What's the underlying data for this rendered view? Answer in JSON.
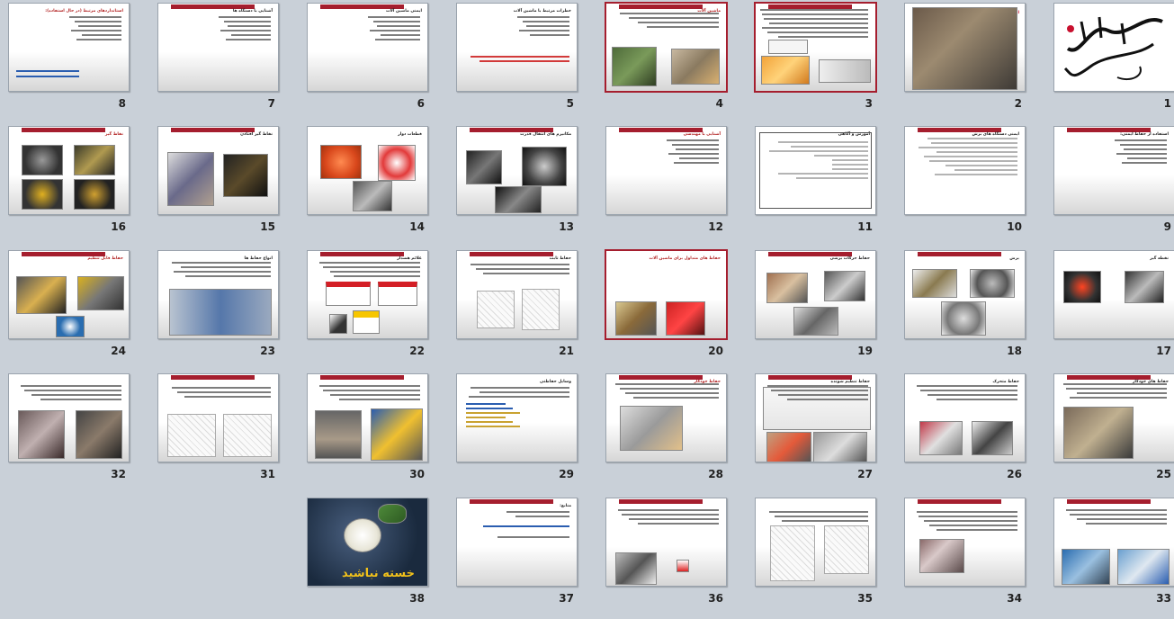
{
  "slides": [
    {
      "number": "1",
      "title": "",
      "kind": "calligraphy"
    },
    {
      "number": "2",
      "title": "ایمنی ماشین آلات",
      "kind": "photo"
    },
    {
      "number": "3",
      "title": "",
      "kind": "text-diagram",
      "selected": true
    },
    {
      "number": "4",
      "title": "ماشین آلات",
      "kind": "text-photos",
      "selected": true
    },
    {
      "number": "5",
      "title": "خطرات مرتبط با ماشین آلات",
      "kind": "list"
    },
    {
      "number": "6",
      "title": "ایمنی ماشین آلات",
      "kind": "list"
    },
    {
      "number": "7",
      "title": "آشنایی با دستگاه ها",
      "kind": "list"
    },
    {
      "number": "8",
      "title": "استانداردهای مرتبط (در حال استفاده):",
      "kind": "list"
    },
    {
      "number": "9",
      "title": "استفاده از حفاظ ایمنی:",
      "kind": "list"
    },
    {
      "number": "10",
      "title": "ایمنی دستگاه های برش",
      "kind": "text"
    },
    {
      "number": "11",
      "title": "آموزش و آگاهی",
      "kind": "framed-text"
    },
    {
      "number": "12",
      "title": "آشنایی با مهندسی",
      "kind": "list"
    },
    {
      "number": "13",
      "title": "مکانیزم های انتقال قدرت",
      "kind": "photos"
    },
    {
      "number": "14",
      "title": "قطعات دوار",
      "kind": "photos"
    },
    {
      "number": "15",
      "title": "نقاط گیر افتادن",
      "kind": "photos"
    },
    {
      "number": "16",
      "title": "نقاط گیر",
      "kind": "photos"
    },
    {
      "number": "17",
      "title": "نقطه گیر",
      "kind": "photos"
    },
    {
      "number": "18",
      "title": "برش",
      "kind": "photos"
    },
    {
      "number": "19",
      "title": "حفاظ حرکات برشی",
      "kind": "photos"
    },
    {
      "number": "20",
      "title": "حفاظ های متداول برای ماشین آلات",
      "kind": "photos",
      "selected": true
    },
    {
      "number": "21",
      "title": "حفاظ ثابت",
      "kind": "diagrams"
    },
    {
      "number": "22",
      "title": "علائم هشدار",
      "kind": "signs"
    },
    {
      "number": "23",
      "title": "انواع حفاظ ها",
      "kind": "photo"
    },
    {
      "number": "24",
      "title": "حفاظ قابل تنظیم",
      "kind": "photos"
    },
    {
      "number": "25",
      "title": "حفاظ های خودکار",
      "kind": "photo"
    },
    {
      "number": "26",
      "title": "حفاظ متحرک",
      "kind": "photos"
    },
    {
      "number": "27",
      "title": "حفاظ تنظیم شونده",
      "kind": "photos"
    },
    {
      "number": "28",
      "title": "حفاظ خودکار",
      "kind": "photo"
    },
    {
      "number": "29",
      "title": "وسایل حفاظتی",
      "kind": "text"
    },
    {
      "number": "30",
      "title": "",
      "kind": "photos"
    },
    {
      "number": "31",
      "title": "",
      "kind": "diagrams"
    },
    {
      "number": "32",
      "title": "",
      "kind": "photos"
    },
    {
      "number": "33",
      "title": "",
      "kind": "photos"
    },
    {
      "number": "34",
      "title": "",
      "kind": "photo"
    },
    {
      "number": "35",
      "title": "",
      "kind": "diagrams"
    },
    {
      "number": "36",
      "title": "",
      "kind": "photos"
    },
    {
      "number": "37",
      "title": "منابع:",
      "kind": "links"
    },
    {
      "number": "38",
      "title": "خسته نباشید",
      "kind": "closing"
    }
  ],
  "colors": {
    "background": "#c9d0d8",
    "accent": "#a51e2e",
    "link": "#2a5db0"
  }
}
